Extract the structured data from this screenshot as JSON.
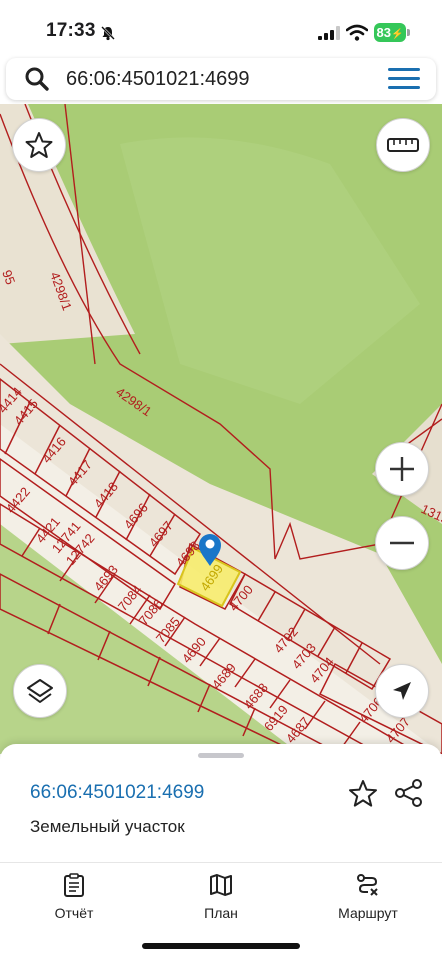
{
  "status_bar": {
    "time": "17:33",
    "battery": "83",
    "icons": [
      "bell-slash-icon",
      "signal-icon",
      "wifi-icon",
      "battery-icon"
    ]
  },
  "search": {
    "query": "66:06:4501021:4699",
    "icon": "search-icon",
    "menu_icon": "hamburger-menu-icon"
  },
  "map": {
    "selected_plot": "4699",
    "plots": [
      "4298/1",
      "4298/1",
      "95",
      "4415",
      "4416",
      "4417",
      "4418",
      "4414",
      "4422",
      "4421",
      "12741",
      "12742",
      "4693",
      "7084",
      "7086",
      "7085",
      "4690",
      "4689",
      "4688",
      "6919",
      "4687",
      "4696",
      "4697",
      "4698",
      "4699",
      "4700",
      "4702",
      "4703",
      "4704",
      "4706",
      "4707",
      "1319"
    ],
    "controls": [
      "favorite-star-icon",
      "ruler-icon",
      "zoom-in-icon",
      "zoom-out-icon",
      "layers-icon",
      "locate-arrow-icon"
    ],
    "colors": {
      "forest": "#a9cc75",
      "road": "#ece5d8",
      "boundary": "#b21e1e",
      "selected_fill": "#f7ec6e",
      "pin": "#1976c8"
    }
  },
  "sheet": {
    "cadastral_number": "66:06:4501021:4699",
    "parcel_type": "Земельный участок"
  },
  "tabs": [
    {
      "label": "Отчёт",
      "icon": "report-clipboard-icon"
    },
    {
      "label": "План",
      "icon": "map-plan-icon"
    },
    {
      "label": "Маршрут",
      "icon": "route-icon"
    }
  ]
}
